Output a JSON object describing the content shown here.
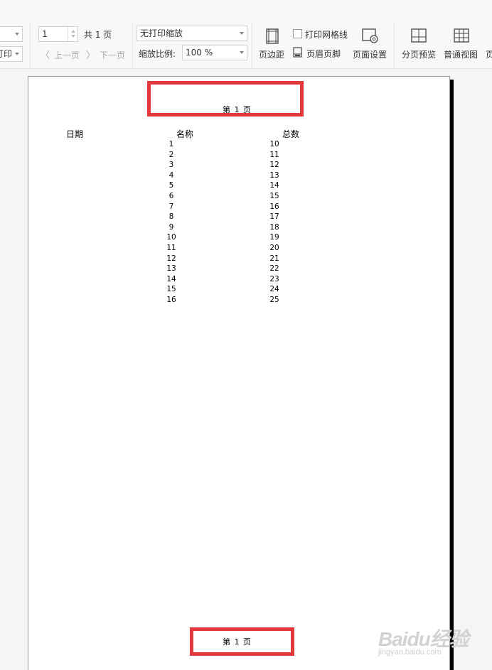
{
  "toolbar": {
    "left_select_value": "",
    "left_print_label": "打印",
    "page_number_value": "1",
    "total_pages": "共 1 页",
    "prev_page": "上一页",
    "next_page": "下一页",
    "scale_mode": "无打印缩放",
    "zoom_label": "缩放比例:",
    "zoom_value": "100 %",
    "margins": "页边距",
    "print_gridlines": "打印网格线",
    "header_footer": "页眉页脚",
    "page_setup": "页面设置",
    "page_break_preview": "分页预览",
    "normal_view": "普通视图",
    "page_more": "页"
  },
  "page": {
    "header_text": "第 1 页",
    "footer_text": "第 1 页",
    "columns": [
      "日期",
      "名称",
      "总数"
    ],
    "names": [
      "1",
      "2",
      "3",
      "4",
      "5",
      "6",
      "7",
      "8",
      "9",
      "10",
      "11",
      "12",
      "13",
      "14",
      "15",
      "16"
    ],
    "totals": [
      "10",
      "11",
      "12",
      "13",
      "14",
      "15",
      "16",
      "17",
      "18",
      "19",
      "20",
      "21",
      "22",
      "23",
      "24",
      "25"
    ]
  },
  "watermark": {
    "brand": "Baidu经验",
    "url": "jingyan.baidu.com"
  },
  "colors": {
    "highlight": "#e4393c",
    "toolbar_bg": "#f7f8fa",
    "canvas_bg": "#f4f5f7"
  }
}
